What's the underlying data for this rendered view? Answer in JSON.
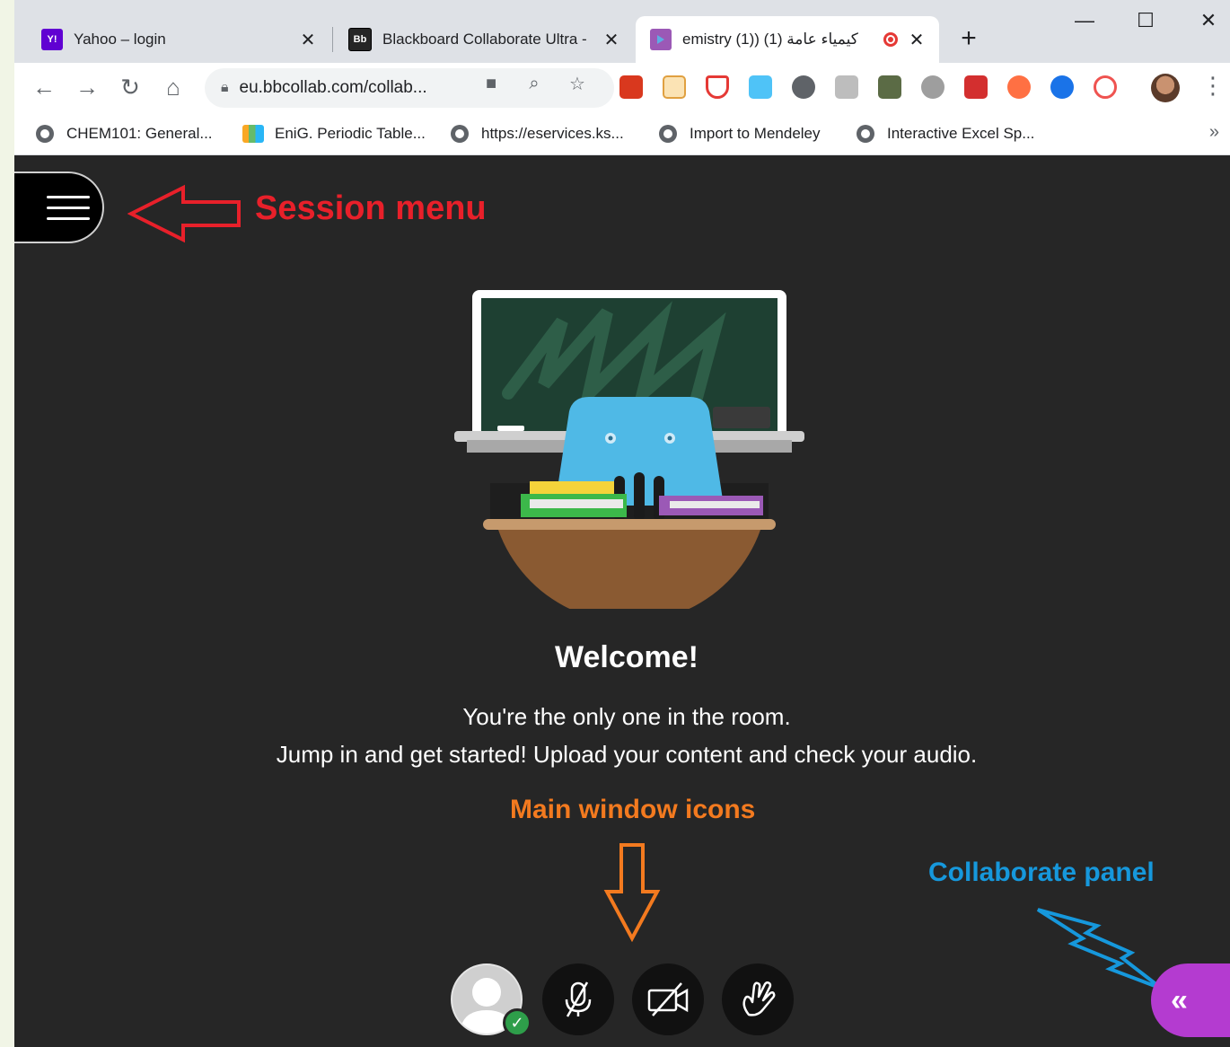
{
  "tabs": [
    {
      "title": "Yahoo – login",
      "favicon": "Y!",
      "favicon_color": "#6001d2"
    },
    {
      "title": "Blackboard Collaborate Ultra -",
      "favicon": "Bb",
      "favicon_color": "#262626"
    },
    {
      "title": "كيمياء عامة (1) ((emistry (1",
      "favicon": "",
      "favicon_color": "#9b59b6",
      "recording": true
    }
  ],
  "toolbar": {
    "url": "eu.bbcollab.com/collab..."
  },
  "bookmarks": [
    {
      "label": "CHEM101: General..."
    },
    {
      "label": "EniG. Periodic Table..."
    },
    {
      "label": "https://eservices.ks..."
    },
    {
      "label": "Import to Mendeley"
    },
    {
      "label": "Interactive Excel Sp..."
    }
  ],
  "annotations": {
    "session_menu": "Session menu",
    "main_window_icons": "Main window icons",
    "collaborate_panel": "Collaborate panel"
  },
  "welcome": {
    "title": "Welcome!",
    "line1": "You're the only one in the room.",
    "line2": "Jump in and get started! Upload your content and check your audio."
  },
  "colors": {
    "content_bg": "#262626",
    "session_annotation": "#e8202a",
    "main_annotation": "#f37a1f",
    "collab_annotation": "#1698dc",
    "collab_button": "#b43bd0"
  }
}
